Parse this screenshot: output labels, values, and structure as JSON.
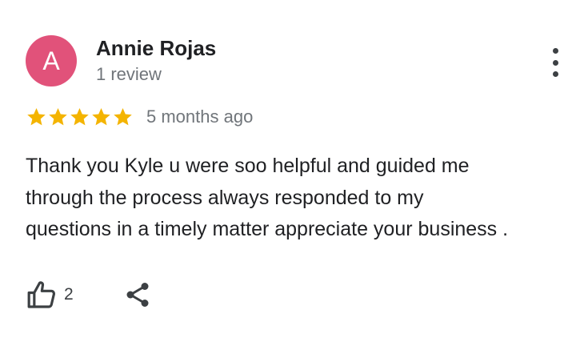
{
  "reviewer": {
    "avatar_initial": "A",
    "avatar_color": "#e1527a",
    "name": "Annie Rojas",
    "review_count": "1 review"
  },
  "menu": {
    "icon": "more-vert-icon"
  },
  "rating": {
    "stars": 5,
    "max_stars": 5,
    "star_color": "#f4b400",
    "date": "5 months ago"
  },
  "review": {
    "text": "Thank you Kyle u were soo helpful and guided me\nthrough the process always responded to my\nquestions in a timely matter appreciate your business ."
  },
  "actions": {
    "like_icon": "thumbs-up-icon",
    "like_count": "2",
    "share_icon": "share-icon"
  }
}
